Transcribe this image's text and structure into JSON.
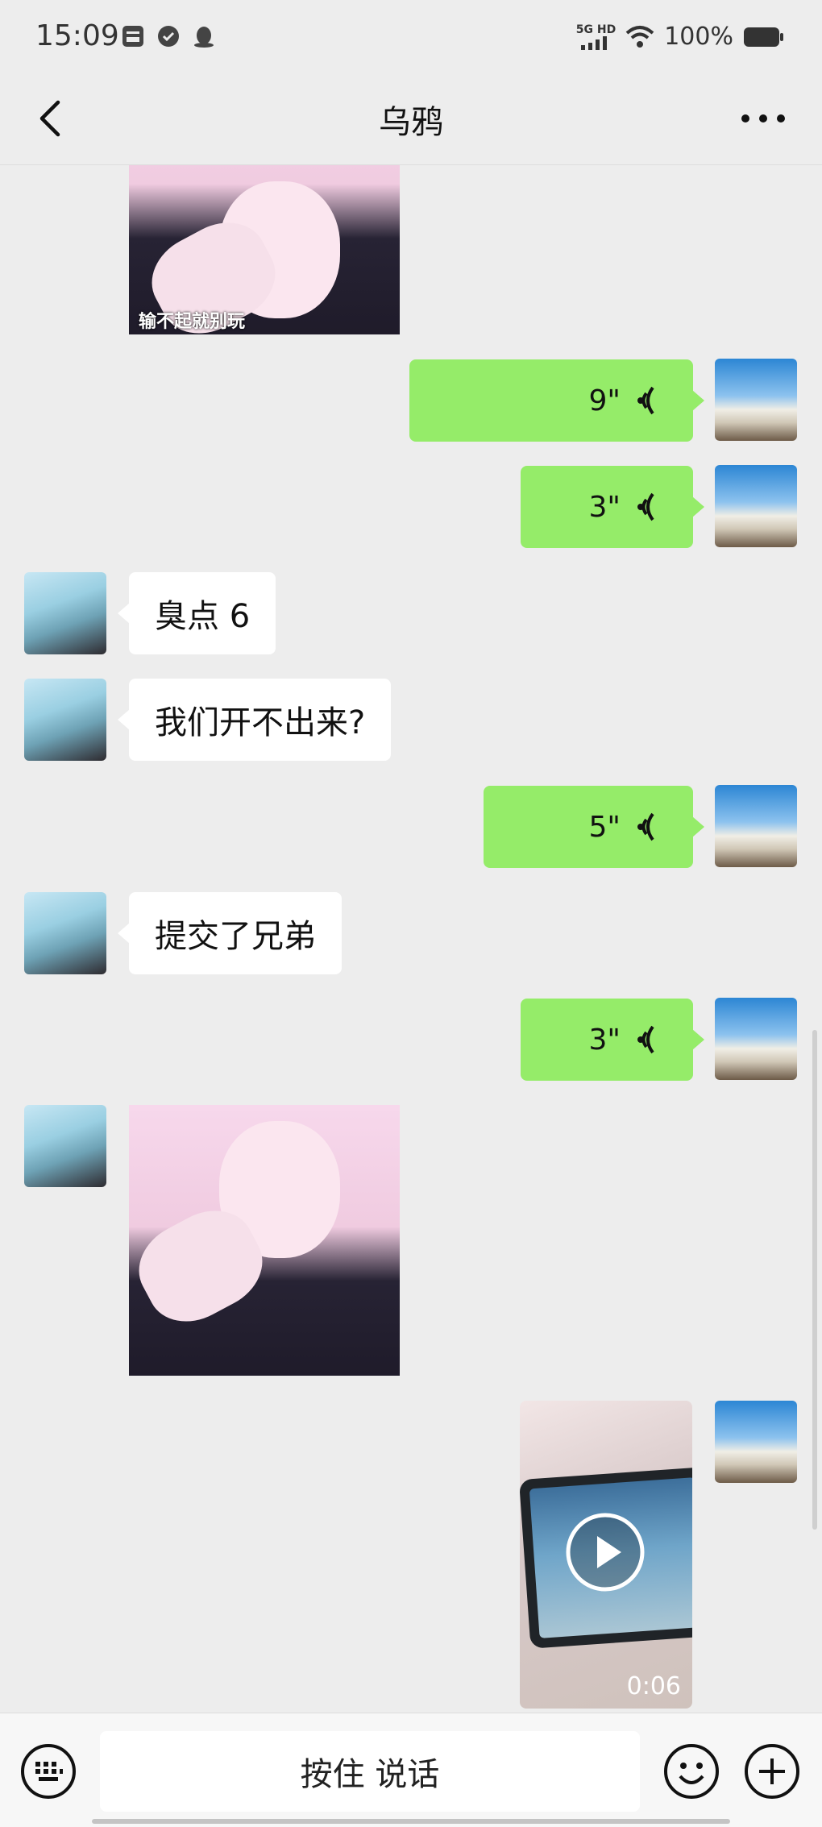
{
  "status_bar": {
    "time": "15:09",
    "network_label": "5G HD",
    "battery": "100%",
    "left_icons": [
      "message-box-icon",
      "check-circle-icon",
      "qq-penguin-icon"
    ],
    "right_icons": [
      "signal-icon",
      "wifi-icon",
      "battery-icon"
    ]
  },
  "header": {
    "title": "乌鸦",
    "back_icon": "chevron-left-icon",
    "more_icon": "more-dots-icon"
  },
  "messages": [
    {
      "sender": "friend",
      "type": "sticker",
      "caption": "输不起就别玩"
    },
    {
      "sender": "self",
      "type": "voice",
      "duration": "9\""
    },
    {
      "sender": "self",
      "type": "voice",
      "duration": "3\""
    },
    {
      "sender": "friend",
      "type": "text",
      "text": "臭点 6"
    },
    {
      "sender": "friend",
      "type": "text",
      "text": "我们开不出来?"
    },
    {
      "sender": "self",
      "type": "voice",
      "duration": "5\""
    },
    {
      "sender": "friend",
      "type": "text",
      "text": "提交了兄弟"
    },
    {
      "sender": "self",
      "type": "voice",
      "duration": "3\""
    },
    {
      "sender": "friend",
      "type": "sticker",
      "caption": ""
    },
    {
      "sender": "self",
      "type": "video",
      "duration": "0:06"
    }
  ],
  "input_bar": {
    "hold_to_talk": "按住 说话",
    "keyboard_icon": "keyboard-icon",
    "emoji_icon": "emoji-icon",
    "plus_icon": "plus-circle-icon"
  },
  "colors": {
    "background": "#ededed",
    "self_bubble": "#95ec69",
    "friend_bubble": "#ffffff"
  }
}
